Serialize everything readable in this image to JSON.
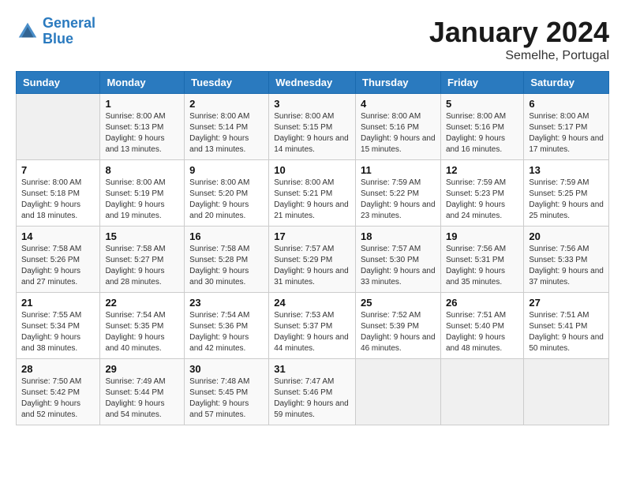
{
  "logo": {
    "line1": "General",
    "line2": "Blue"
  },
  "title": "January 2024",
  "subtitle": "Semelhe, Portugal",
  "header": {
    "days": [
      "Sunday",
      "Monday",
      "Tuesday",
      "Wednesday",
      "Thursday",
      "Friday",
      "Saturday"
    ]
  },
  "weeks": [
    [
      {
        "day": "",
        "sunrise": "",
        "sunset": "",
        "daylight": ""
      },
      {
        "day": "1",
        "sunrise": "Sunrise: 8:00 AM",
        "sunset": "Sunset: 5:13 PM",
        "daylight": "Daylight: 9 hours and 13 minutes."
      },
      {
        "day": "2",
        "sunrise": "Sunrise: 8:00 AM",
        "sunset": "Sunset: 5:14 PM",
        "daylight": "Daylight: 9 hours and 13 minutes."
      },
      {
        "day": "3",
        "sunrise": "Sunrise: 8:00 AM",
        "sunset": "Sunset: 5:15 PM",
        "daylight": "Daylight: 9 hours and 14 minutes."
      },
      {
        "day": "4",
        "sunrise": "Sunrise: 8:00 AM",
        "sunset": "Sunset: 5:16 PM",
        "daylight": "Daylight: 9 hours and 15 minutes."
      },
      {
        "day": "5",
        "sunrise": "Sunrise: 8:00 AM",
        "sunset": "Sunset: 5:16 PM",
        "daylight": "Daylight: 9 hours and 16 minutes."
      },
      {
        "day": "6",
        "sunrise": "Sunrise: 8:00 AM",
        "sunset": "Sunset: 5:17 PM",
        "daylight": "Daylight: 9 hours and 17 minutes."
      }
    ],
    [
      {
        "day": "7",
        "sunrise": "Sunrise: 8:00 AM",
        "sunset": "Sunset: 5:18 PM",
        "daylight": "Daylight: 9 hours and 18 minutes."
      },
      {
        "day": "8",
        "sunrise": "Sunrise: 8:00 AM",
        "sunset": "Sunset: 5:19 PM",
        "daylight": "Daylight: 9 hours and 19 minutes."
      },
      {
        "day": "9",
        "sunrise": "Sunrise: 8:00 AM",
        "sunset": "Sunset: 5:20 PM",
        "daylight": "Daylight: 9 hours and 20 minutes."
      },
      {
        "day": "10",
        "sunrise": "Sunrise: 8:00 AM",
        "sunset": "Sunset: 5:21 PM",
        "daylight": "Daylight: 9 hours and 21 minutes."
      },
      {
        "day": "11",
        "sunrise": "Sunrise: 7:59 AM",
        "sunset": "Sunset: 5:22 PM",
        "daylight": "Daylight: 9 hours and 23 minutes."
      },
      {
        "day": "12",
        "sunrise": "Sunrise: 7:59 AM",
        "sunset": "Sunset: 5:23 PM",
        "daylight": "Daylight: 9 hours and 24 minutes."
      },
      {
        "day": "13",
        "sunrise": "Sunrise: 7:59 AM",
        "sunset": "Sunset: 5:25 PM",
        "daylight": "Daylight: 9 hours and 25 minutes."
      }
    ],
    [
      {
        "day": "14",
        "sunrise": "Sunrise: 7:58 AM",
        "sunset": "Sunset: 5:26 PM",
        "daylight": "Daylight: 9 hours and 27 minutes."
      },
      {
        "day": "15",
        "sunrise": "Sunrise: 7:58 AM",
        "sunset": "Sunset: 5:27 PM",
        "daylight": "Daylight: 9 hours and 28 minutes."
      },
      {
        "day": "16",
        "sunrise": "Sunrise: 7:58 AM",
        "sunset": "Sunset: 5:28 PM",
        "daylight": "Daylight: 9 hours and 30 minutes."
      },
      {
        "day": "17",
        "sunrise": "Sunrise: 7:57 AM",
        "sunset": "Sunset: 5:29 PM",
        "daylight": "Daylight: 9 hours and 31 minutes."
      },
      {
        "day": "18",
        "sunrise": "Sunrise: 7:57 AM",
        "sunset": "Sunset: 5:30 PM",
        "daylight": "Daylight: 9 hours and 33 minutes."
      },
      {
        "day": "19",
        "sunrise": "Sunrise: 7:56 AM",
        "sunset": "Sunset: 5:31 PM",
        "daylight": "Daylight: 9 hours and 35 minutes."
      },
      {
        "day": "20",
        "sunrise": "Sunrise: 7:56 AM",
        "sunset": "Sunset: 5:33 PM",
        "daylight": "Daylight: 9 hours and 37 minutes."
      }
    ],
    [
      {
        "day": "21",
        "sunrise": "Sunrise: 7:55 AM",
        "sunset": "Sunset: 5:34 PM",
        "daylight": "Daylight: 9 hours and 38 minutes."
      },
      {
        "day": "22",
        "sunrise": "Sunrise: 7:54 AM",
        "sunset": "Sunset: 5:35 PM",
        "daylight": "Daylight: 9 hours and 40 minutes."
      },
      {
        "day": "23",
        "sunrise": "Sunrise: 7:54 AM",
        "sunset": "Sunset: 5:36 PM",
        "daylight": "Daylight: 9 hours and 42 minutes."
      },
      {
        "day": "24",
        "sunrise": "Sunrise: 7:53 AM",
        "sunset": "Sunset: 5:37 PM",
        "daylight": "Daylight: 9 hours and 44 minutes."
      },
      {
        "day": "25",
        "sunrise": "Sunrise: 7:52 AM",
        "sunset": "Sunset: 5:39 PM",
        "daylight": "Daylight: 9 hours and 46 minutes."
      },
      {
        "day": "26",
        "sunrise": "Sunrise: 7:51 AM",
        "sunset": "Sunset: 5:40 PM",
        "daylight": "Daylight: 9 hours and 48 minutes."
      },
      {
        "day": "27",
        "sunrise": "Sunrise: 7:51 AM",
        "sunset": "Sunset: 5:41 PM",
        "daylight": "Daylight: 9 hours and 50 minutes."
      }
    ],
    [
      {
        "day": "28",
        "sunrise": "Sunrise: 7:50 AM",
        "sunset": "Sunset: 5:42 PM",
        "daylight": "Daylight: 9 hours and 52 minutes."
      },
      {
        "day": "29",
        "sunrise": "Sunrise: 7:49 AM",
        "sunset": "Sunset: 5:44 PM",
        "daylight": "Daylight: 9 hours and 54 minutes."
      },
      {
        "day": "30",
        "sunrise": "Sunrise: 7:48 AM",
        "sunset": "Sunset: 5:45 PM",
        "daylight": "Daylight: 9 hours and 57 minutes."
      },
      {
        "day": "31",
        "sunrise": "Sunrise: 7:47 AM",
        "sunset": "Sunset: 5:46 PM",
        "daylight": "Daylight: 9 hours and 59 minutes."
      },
      {
        "day": "",
        "sunrise": "",
        "sunset": "",
        "daylight": ""
      },
      {
        "day": "",
        "sunrise": "",
        "sunset": "",
        "daylight": ""
      },
      {
        "day": "",
        "sunrise": "",
        "sunset": "",
        "daylight": ""
      }
    ]
  ]
}
